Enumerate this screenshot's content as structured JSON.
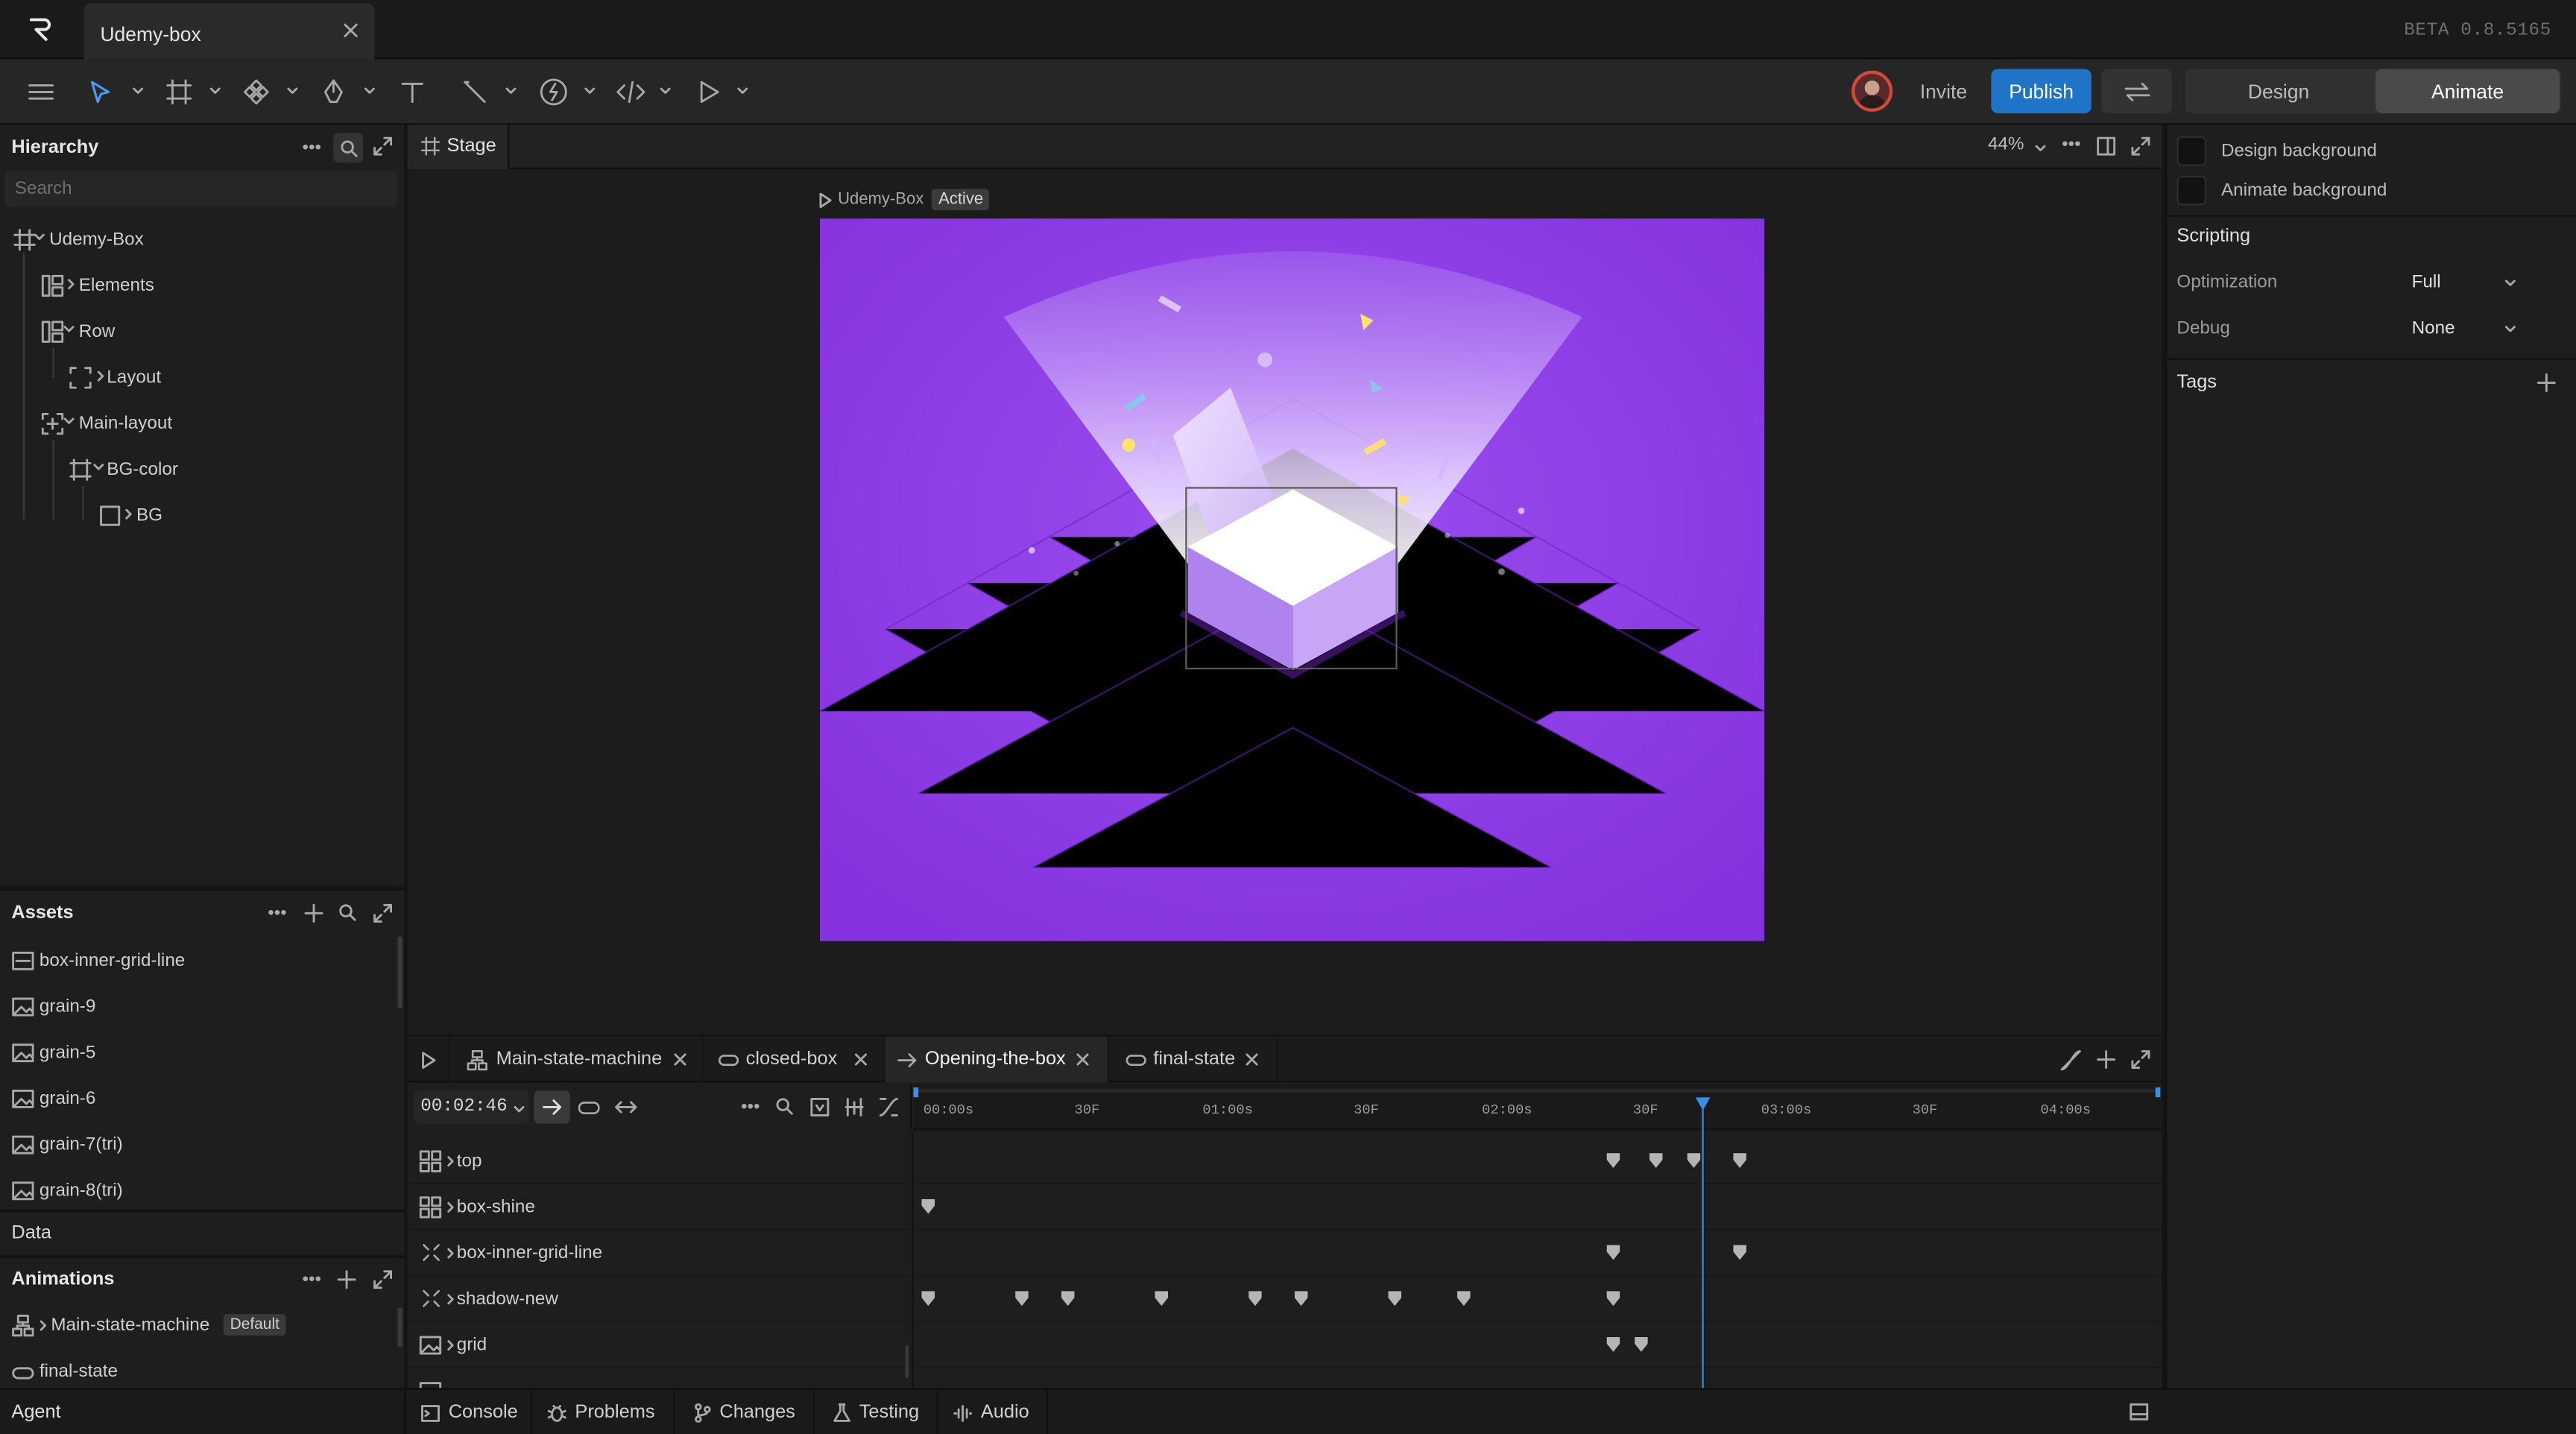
{
  "app": {
    "document_tab": "Udemy-box",
    "version": "BETA 0.8.5165"
  },
  "toolbar": {
    "invite": "Invite",
    "publish": "Publish",
    "mode_design": "Design",
    "mode_animate": "Animate"
  },
  "hierarchy": {
    "title": "Hierarchy",
    "search_placeholder": "Search",
    "items": [
      {
        "label": "Udemy-Box"
      },
      {
        "label": "Elements"
      },
      {
        "label": "Row"
      },
      {
        "label": "Layout"
      },
      {
        "label": "Main-layout"
      },
      {
        "label": "BG-color"
      },
      {
        "label": "BG"
      }
    ]
  },
  "assets": {
    "title": "Assets",
    "items": [
      "box-inner-grid-line",
      "grain-9",
      "grain-5",
      "grain-6",
      "grain-7(tri)",
      "grain-8(tri)"
    ]
  },
  "data_section": {
    "title": "Data"
  },
  "animations": {
    "title": "Animations",
    "items": [
      {
        "label": "Main-state-machine",
        "badge": "Default"
      },
      {
        "label": "final-state"
      }
    ]
  },
  "agent": {
    "title": "Agent"
  },
  "stage": {
    "tab": "Stage",
    "zoom": "44%",
    "artboard_name": "Udemy-Box",
    "artboard_badge": "Active"
  },
  "timeline": {
    "tabs": [
      "Main-state-machine",
      "closed-box",
      "Opening-the-box",
      "final-state"
    ],
    "time": "00:02:46",
    "ruler": [
      "00:00s",
      "30F",
      "01:00s",
      "30F",
      "02:00s",
      "30F",
      "03:00s",
      "30F",
      "04:00s"
    ],
    "tracks": [
      "top",
      "box-shine",
      "box-inner-grid-line",
      "shadow-new",
      "grid"
    ],
    "playhead_seconds": 2.77
  },
  "bottom": {
    "tabs": [
      "Console",
      "Problems",
      "Changes",
      "Testing",
      "Audio"
    ]
  },
  "inspector": {
    "design_background": "Design background",
    "animate_background": "Animate background",
    "scripting": "Scripting",
    "optimization_label": "Optimization",
    "optimization_value": "Full",
    "debug_label": "Debug",
    "debug_value": "None",
    "tags": "Tags"
  },
  "colors": {
    "accent": "#1f74c8",
    "artboard": "#8a38e0",
    "playhead": "#3a8ee6"
  }
}
